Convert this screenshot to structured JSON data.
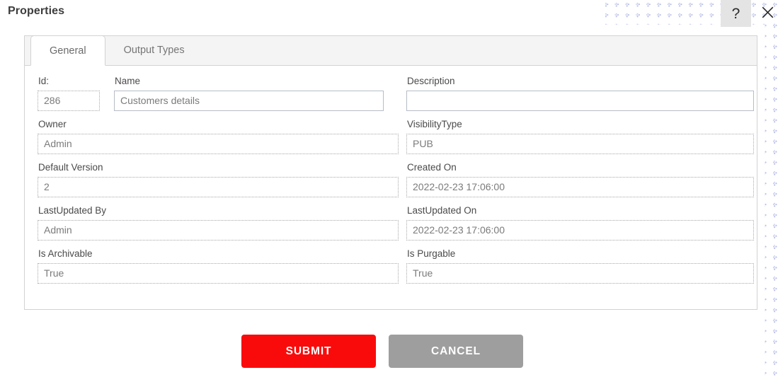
{
  "window": {
    "title": "Properties",
    "help_icon": "question-mark-icon",
    "help_label": "?",
    "close_icon": "close-icon"
  },
  "tabs": [
    {
      "label": "General",
      "active": true
    },
    {
      "label": "Output Types",
      "active": false
    }
  ],
  "form": {
    "id": {
      "label": "Id:",
      "value": "286",
      "placeholder": "",
      "readonly": true
    },
    "name": {
      "label": "Name",
      "value": "Customers details",
      "placeholder": "",
      "readonly": false
    },
    "description": {
      "label": "Description",
      "value": "",
      "placeholder": "",
      "readonly": false
    },
    "owner": {
      "label": "Owner",
      "value": "Admin",
      "placeholder": "",
      "readonly": true
    },
    "visibility_type": {
      "label": "VisibilityType",
      "value": "PUB",
      "placeholder": "",
      "readonly": true
    },
    "default_version": {
      "label": "Default Version",
      "value": "2",
      "placeholder": "",
      "readonly": true
    },
    "created_on": {
      "label": "Created On",
      "value": "2022-02-23 17:06:00",
      "placeholder": "",
      "readonly": true
    },
    "lastupdated_by": {
      "label": "LastUpdated By",
      "value": "Admin",
      "placeholder": "",
      "readonly": true
    },
    "lastupdated_on": {
      "label": "LastUpdated On",
      "value": "2022-02-23 17:06:00",
      "placeholder": "",
      "readonly": true
    },
    "is_archivable": {
      "label": "Is Archivable",
      "value": "True",
      "placeholder": "",
      "readonly": true
    },
    "is_purgable": {
      "label": "Is Purgable",
      "value": "True",
      "placeholder": "",
      "readonly": true
    }
  },
  "footer": {
    "submit_label": "SUBMIT",
    "cancel_label": "CANCEL"
  },
  "colors": {
    "submit_red": "#FA0B0B",
    "cancel_gray": "#9E9E9E",
    "tabstrip_gray": "#F4F4F4",
    "border_gray": "#D2D2D2",
    "pattern_blue": "#B9BFE6"
  }
}
